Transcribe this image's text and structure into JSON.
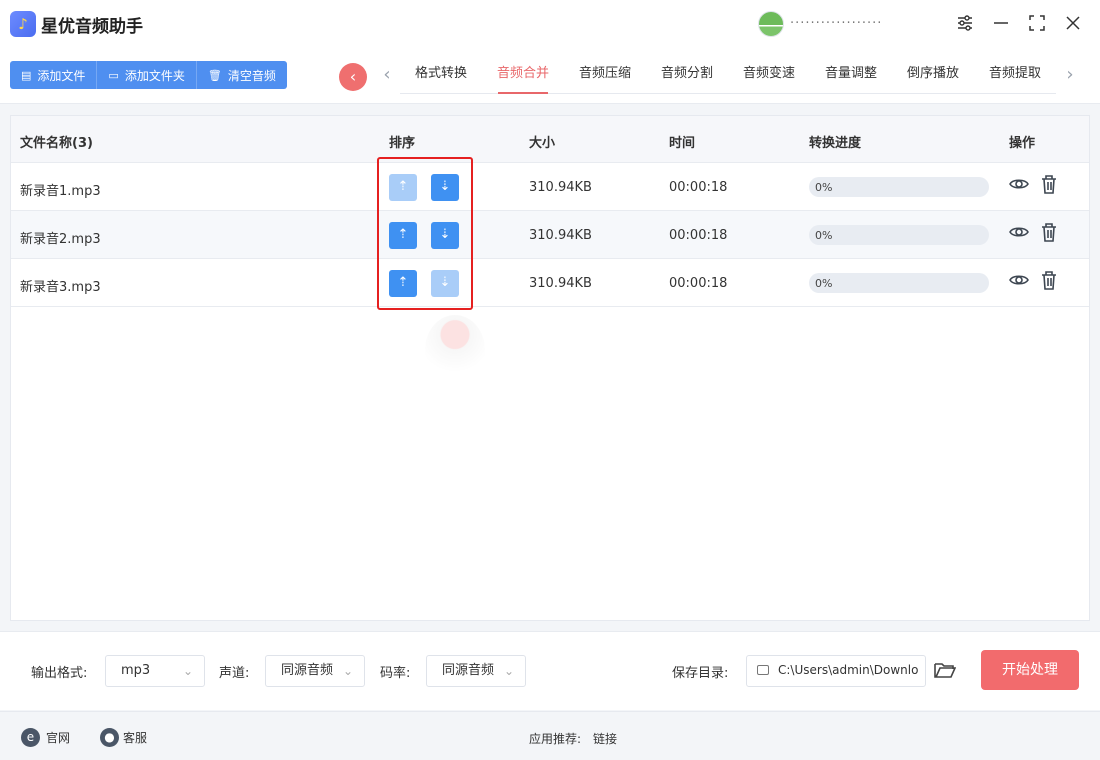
{
  "app": {
    "title": "星优音频助手",
    "user_text": "··················"
  },
  "toolbar": {
    "add_file": "添加文件",
    "add_folder": "添加文件夹",
    "clear": "清空音频"
  },
  "tabs": [
    "格式转换",
    "音频合并",
    "音频压缩",
    "音频分割",
    "音频变速",
    "音量调整",
    "倒序播放",
    "音频提取"
  ],
  "active_tab": 1,
  "table": {
    "headers": {
      "name": "文件名称(3)",
      "sort": "排序",
      "size": "大小",
      "time": "时间",
      "progress": "转换进度",
      "actions": "操作"
    },
    "rows": [
      {
        "name": "新录音1.mp3",
        "size": "310.94KB",
        "time": "00:00:18",
        "progress": "0%",
        "progress_value": 0,
        "up_enabled": false,
        "down_enabled": true
      },
      {
        "name": "新录音2.mp3",
        "size": "310.94KB",
        "time": "00:00:18",
        "progress": "0%",
        "progress_value": 0,
        "up_enabled": true,
        "down_enabled": true
      },
      {
        "name": "新录音3.mp3",
        "size": "310.94KB",
        "time": "00:00:18",
        "progress": "0%",
        "progress_value": 0,
        "up_enabled": true,
        "down_enabled": false
      }
    ]
  },
  "settings": {
    "output_format_label": "输出格式:",
    "output_format_value": "mp3",
    "channel_label": "声道:",
    "channel_value": "同源音频",
    "bitrate_label": "码率:",
    "bitrate_value": "同源音频",
    "save_dir_label": "保存目录:",
    "save_dir_value": "C:\\Users\\admin\\Downlo",
    "start_button": "开始处理"
  },
  "footer": {
    "website": "官网",
    "service": "客服",
    "recommend_label": "应用推荐:",
    "recommend_link": "链接"
  },
  "colors": {
    "accent": "#4f8ff0",
    "active_tab": "#e8676a",
    "start_button": "#f26b6d",
    "highlight": "#e52020"
  }
}
